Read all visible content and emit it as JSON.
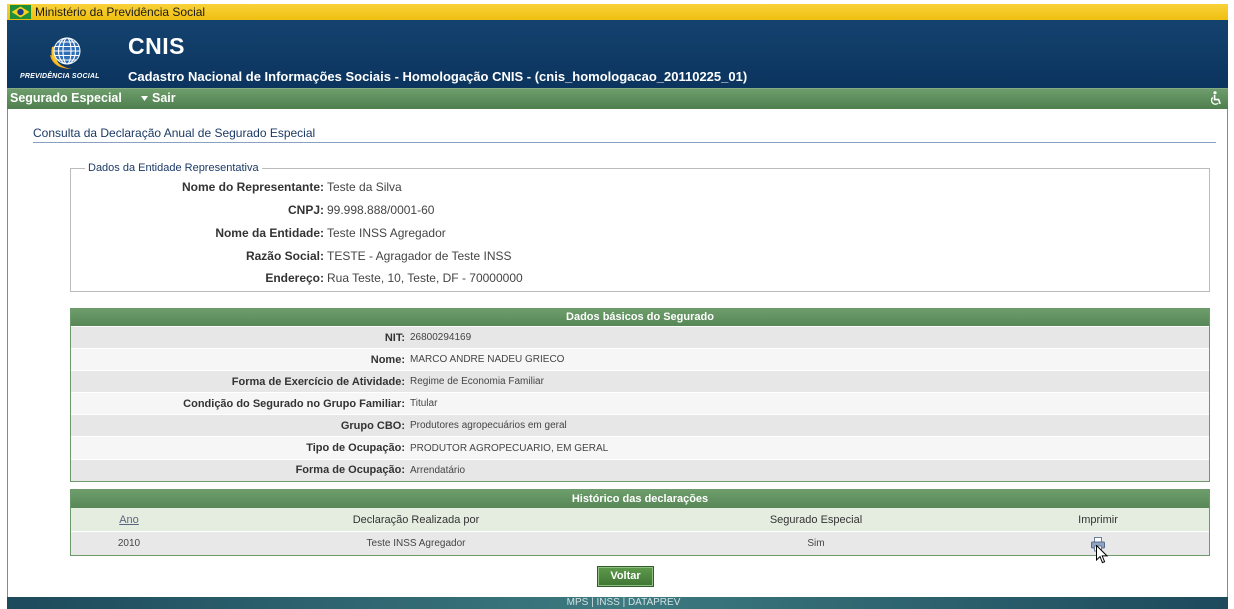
{
  "top_bar": {
    "flag_icon": "brazil-flag-icon",
    "ministry": "Ministério da Previdência Social"
  },
  "header": {
    "logo_icon": "previdencia-social-logo",
    "logo_caption": "PREVIDÊNCIA SOCIAL",
    "app_name": "CNIS",
    "title": "Cadastro Nacional de Informações Sociais - Homologação CNIS - (cnis_homologacao_20110225_01)"
  },
  "nav": {
    "items": [
      {
        "label": "Segurado Especial",
        "icon": "chevron-down-icon"
      },
      {
        "label": "Sair"
      }
    ],
    "accessibility_icon": "wheelchair-icon"
  },
  "page": {
    "title": "Consulta da Declaração Anual de Segurado Especial"
  },
  "entity": {
    "legend": "Dados da Entidade Representativa",
    "rows": [
      {
        "label": "Nome do Representante:",
        "value": "Teste da Silva"
      },
      {
        "label": "CNPJ:",
        "value": "99.998.888/0001-60"
      },
      {
        "label": "Nome da Entidade:",
        "value": "Teste INSS Agregador"
      },
      {
        "label": "Razão Social:",
        "value": "TESTE - Agragador de Teste INSS"
      },
      {
        "label": "Endereço:",
        "value": "Rua Teste, 10, Teste, DF - 70000000"
      }
    ]
  },
  "insured": {
    "header": "Dados básicos do Segurado",
    "rows": [
      {
        "label": "NIT:",
        "value": "26800294169"
      },
      {
        "label": "Nome:",
        "value": "MARCO ANDRE NADEU GRIECO"
      },
      {
        "label": "Forma de Exercício de Atividade:",
        "value": "Regime de Economia Familiar"
      },
      {
        "label": "Condição do Segurado no Grupo Familiar:",
        "value": "Titular"
      },
      {
        "label": "Grupo CBO:",
        "value": "Produtores agropecuários em geral"
      },
      {
        "label": "Tipo de Ocupação:",
        "value": "PRODUTOR AGROPECUARIO, EM GERAL"
      },
      {
        "label": "Forma de Ocupação:",
        "value": "Arrendatário"
      }
    ]
  },
  "history": {
    "header": "Histórico das declarações",
    "columns": [
      "Ano",
      "Declaração Realizada por",
      "Segurado Especial",
      "Imprimir"
    ],
    "rows": [
      {
        "ano": "2010",
        "declarante": "Teste INSS Agregador",
        "segurado_especial": "Sim",
        "print_icon": "print-icon"
      }
    ]
  },
  "actions": {
    "back_label": "Voltar"
  },
  "footer": {
    "text": "MPS | INSS | DATAPREV"
  },
  "colors": {
    "gov_yellow": "#f4c417",
    "header_blue": "#0e3b69",
    "nav_green": "#5b8b5a",
    "table_header_green": "#5d8d5c",
    "title_blue": "#1c3a66",
    "button_green": "#4b8440"
  }
}
